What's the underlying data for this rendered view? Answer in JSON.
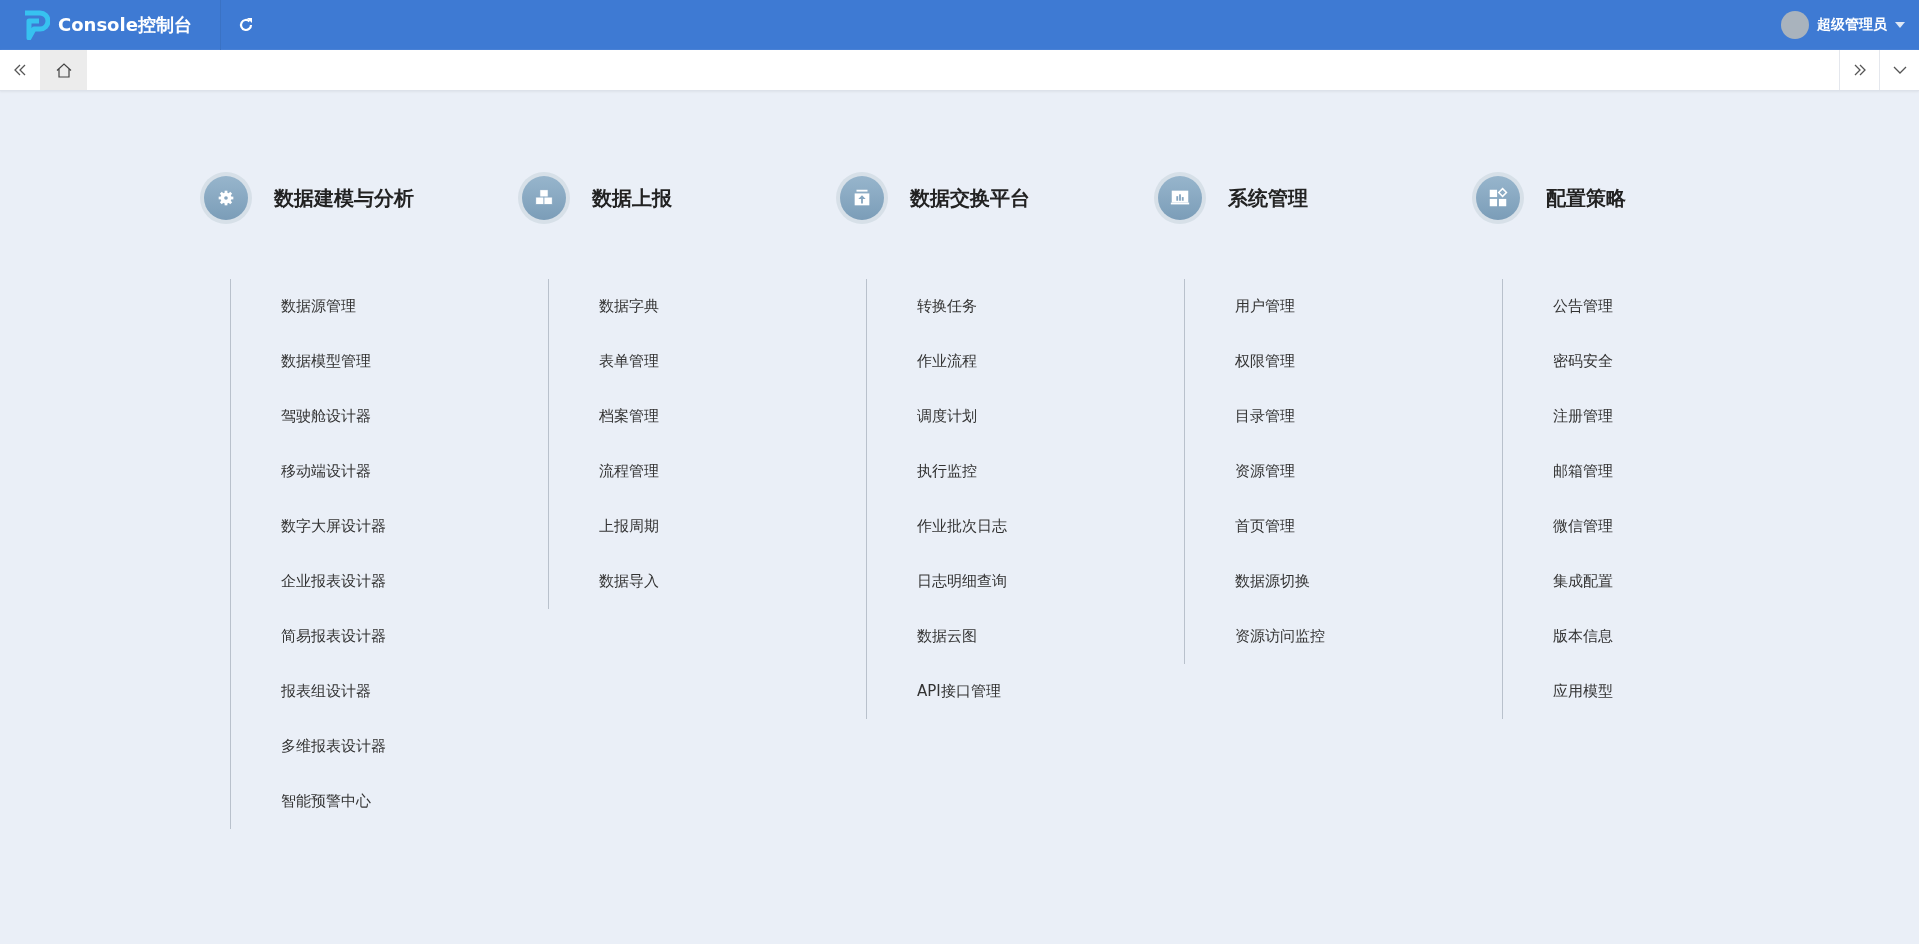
{
  "header": {
    "title": "Console控制台",
    "user": {
      "name": "超级管理员"
    }
  },
  "tabs": [
    {
      "kind": "home",
      "selected": true
    }
  ],
  "categories": [
    {
      "title": "数据建模与分析",
      "items": [
        "数据源管理",
        "数据模型管理",
        "驾驶舱设计器",
        "移动端设计器",
        "数字大屏设计器",
        "企业报表设计器",
        "简易报表设计器",
        "报表组设计器",
        "多维报表设计器",
        "智能预警中心"
      ]
    },
    {
      "title": "数据上报",
      "items": [
        "数据字典",
        "表单管理",
        "档案管理",
        "流程管理",
        "上报周期",
        "数据导入"
      ]
    },
    {
      "title": "数据交换平台",
      "items": [
        "转换任务",
        "作业流程",
        "调度计划",
        "执行监控",
        "作业批次日志",
        "日志明细查询",
        "数据云图",
        "API接口管理"
      ]
    },
    {
      "title": "系统管理",
      "items": [
        "用户管理",
        "权限管理",
        "目录管理",
        "资源管理",
        "首页管理",
        "数据源切换",
        "资源访问监控"
      ]
    },
    {
      "title": "配置策略",
      "items": [
        "公告管理",
        "密码安全",
        "注册管理",
        "邮箱管理",
        "微信管理",
        "集成配置",
        "版本信息",
        "应用模型"
      ]
    }
  ]
}
